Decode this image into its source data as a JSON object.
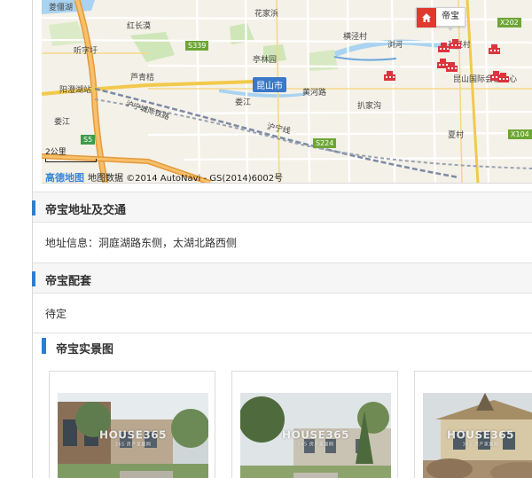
{
  "map": {
    "pin_label": "帝宝",
    "city_label": "昆山市",
    "scale_label": "2公里",
    "copyright_logo": "高德地图",
    "copyright_text": "地图数据 ©2014 AutoNavi - GS(2014)6002号",
    "places": {
      "p1": "菱僵湖",
      "p2": "花家浜",
      "p3": "红长漠",
      "p4": "横泾村",
      "p5": "孙泾村",
      "p6": "听字圩",
      "p7": "亭林园",
      "p8": "芦青桔",
      "p9": "阳澄湖站",
      "p10": "黄河路",
      "p11": "昆山国际会议中心",
      "p12": "娄江",
      "p13": "扒家沟",
      "p14": "沪宁城际铁路",
      "p15": "沪宁线",
      "p16": "夏村",
      "p17": "娄江",
      "p18": "浏河"
    },
    "shields": {
      "s339": "S339",
      "s5": "S5",
      "s224": "S224",
      "x202": "X202",
      "x104": "X104"
    }
  },
  "sections": {
    "address_title": "帝宝地址及交通",
    "address_text": "地址信息：洞庭湖路东侧，太湖北路西侧",
    "facilities_title": "帝宝配套",
    "facilities_text": "待定",
    "photos_title": "帝宝实景图"
  },
  "photos": {
    "watermark": "HOUSE365",
    "watermark_sub": "365 房产家居网"
  }
}
